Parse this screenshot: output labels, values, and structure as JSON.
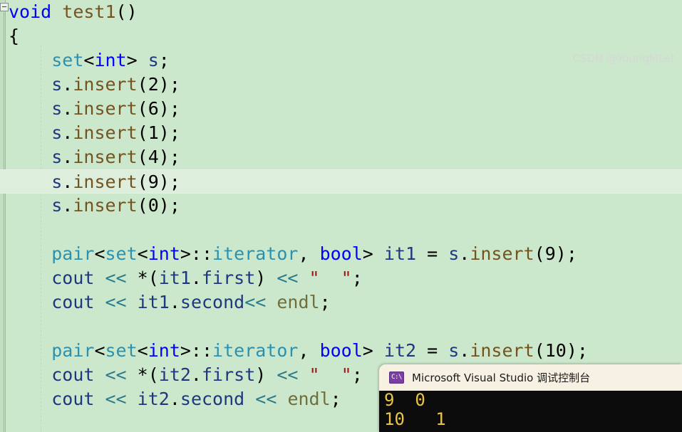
{
  "editor": {
    "outline_marker": "collapse-minus",
    "current_line_index": 7,
    "lines": [
      {
        "indent": 0,
        "tokens": [
          {
            "t": "void",
            "c": "kw"
          },
          {
            "t": " ",
            "c": "op"
          },
          {
            "t": "test1",
            "c": "fn"
          },
          {
            "t": "()",
            "c": "op"
          }
        ]
      },
      {
        "indent": 0,
        "tokens": [
          {
            "t": "{",
            "c": "op"
          }
        ]
      },
      {
        "indent": 1,
        "tokens": [
          {
            "t": "set",
            "c": "type"
          },
          {
            "t": "<",
            "c": "op"
          },
          {
            "t": "int",
            "c": "kw"
          },
          {
            "t": "> ",
            "c": "op"
          },
          {
            "t": "s",
            "c": "var"
          },
          {
            "t": ";",
            "c": "op"
          }
        ]
      },
      {
        "indent": 1,
        "tokens": [
          {
            "t": "s",
            "c": "var"
          },
          {
            "t": ".",
            "c": "op"
          },
          {
            "t": "insert",
            "c": "fn"
          },
          {
            "t": "(",
            "c": "op"
          },
          {
            "t": "2",
            "c": "num"
          },
          {
            "t": ");",
            "c": "op"
          }
        ]
      },
      {
        "indent": 1,
        "tokens": [
          {
            "t": "s",
            "c": "var"
          },
          {
            "t": ".",
            "c": "op"
          },
          {
            "t": "insert",
            "c": "fn"
          },
          {
            "t": "(",
            "c": "op"
          },
          {
            "t": "6",
            "c": "num"
          },
          {
            "t": ");",
            "c": "op"
          }
        ]
      },
      {
        "indent": 1,
        "tokens": [
          {
            "t": "s",
            "c": "var"
          },
          {
            "t": ".",
            "c": "op"
          },
          {
            "t": "insert",
            "c": "fn"
          },
          {
            "t": "(",
            "c": "op"
          },
          {
            "t": "1",
            "c": "num"
          },
          {
            "t": ");",
            "c": "op"
          }
        ]
      },
      {
        "indent": 1,
        "tokens": [
          {
            "t": "s",
            "c": "var"
          },
          {
            "t": ".",
            "c": "op"
          },
          {
            "t": "insert",
            "c": "fn"
          },
          {
            "t": "(",
            "c": "op"
          },
          {
            "t": "4",
            "c": "num"
          },
          {
            "t": ");",
            "c": "op"
          }
        ]
      },
      {
        "indent": 1,
        "tokens": [
          {
            "t": "s",
            "c": "var"
          },
          {
            "t": ".",
            "c": "op"
          },
          {
            "t": "insert",
            "c": "fn"
          },
          {
            "t": "(",
            "c": "op"
          },
          {
            "t": "9",
            "c": "num"
          },
          {
            "t": ");",
            "c": "op"
          }
        ]
      },
      {
        "indent": 1,
        "tokens": [
          {
            "t": "s",
            "c": "var"
          },
          {
            "t": ".",
            "c": "op"
          },
          {
            "t": "insert",
            "c": "fn"
          },
          {
            "t": "(",
            "c": "op"
          },
          {
            "t": "0",
            "c": "num"
          },
          {
            "t": ");",
            "c": "op"
          }
        ]
      },
      {
        "indent": 0,
        "tokens": []
      },
      {
        "indent": 1,
        "tokens": [
          {
            "t": "pair",
            "c": "type"
          },
          {
            "t": "<",
            "c": "op"
          },
          {
            "t": "set",
            "c": "type"
          },
          {
            "t": "<",
            "c": "op"
          },
          {
            "t": "int",
            "c": "kw"
          },
          {
            "t": ">::",
            "c": "op"
          },
          {
            "t": "iterator",
            "c": "type"
          },
          {
            "t": ", ",
            "c": "op"
          },
          {
            "t": "bool",
            "c": "kw"
          },
          {
            "t": "> ",
            "c": "op"
          },
          {
            "t": "it1",
            "c": "var"
          },
          {
            "t": " = ",
            "c": "op"
          },
          {
            "t": "s",
            "c": "var"
          },
          {
            "t": ".",
            "c": "op"
          },
          {
            "t": "insert",
            "c": "fn"
          },
          {
            "t": "(",
            "c": "op"
          },
          {
            "t": "9",
            "c": "num"
          },
          {
            "t": ");",
            "c": "op"
          }
        ]
      },
      {
        "indent": 1,
        "tokens": [
          {
            "t": "cout",
            "c": "var"
          },
          {
            "t": " ",
            "c": "op"
          },
          {
            "t": "<<",
            "c": "shift"
          },
          {
            "t": " *(",
            "c": "op"
          },
          {
            "t": "it1",
            "c": "var"
          },
          {
            "t": ".",
            "c": "op"
          },
          {
            "t": "first",
            "c": "var"
          },
          {
            "t": ") ",
            "c": "op"
          },
          {
            "t": "<<",
            "c": "shift"
          },
          {
            "t": " ",
            "c": "op"
          },
          {
            "t": "\"  \"",
            "c": "str"
          },
          {
            "t": ";",
            "c": "op"
          }
        ]
      },
      {
        "indent": 1,
        "tokens": [
          {
            "t": "cout",
            "c": "var"
          },
          {
            "t": " ",
            "c": "op"
          },
          {
            "t": "<<",
            "c": "shift"
          },
          {
            "t": " ",
            "c": "op"
          },
          {
            "t": "it1",
            "c": "var"
          },
          {
            "t": ".",
            "c": "op"
          },
          {
            "t": "second",
            "c": "var"
          },
          {
            "t": "<<",
            "c": "shift"
          },
          {
            "t": " ",
            "c": "op"
          },
          {
            "t": "endl",
            "c": "macro"
          },
          {
            "t": ";",
            "c": "op"
          }
        ]
      },
      {
        "indent": 0,
        "tokens": []
      },
      {
        "indent": 1,
        "tokens": [
          {
            "t": "pair",
            "c": "type"
          },
          {
            "t": "<",
            "c": "op"
          },
          {
            "t": "set",
            "c": "type"
          },
          {
            "t": "<",
            "c": "op"
          },
          {
            "t": "int",
            "c": "kw"
          },
          {
            "t": ">::",
            "c": "op"
          },
          {
            "t": "iterator",
            "c": "type"
          },
          {
            "t": ", ",
            "c": "op"
          },
          {
            "t": "bool",
            "c": "kw"
          },
          {
            "t": "> ",
            "c": "op"
          },
          {
            "t": "it2",
            "c": "var"
          },
          {
            "t": " = ",
            "c": "op"
          },
          {
            "t": "s",
            "c": "var"
          },
          {
            "t": ".",
            "c": "op"
          },
          {
            "t": "insert",
            "c": "fn"
          },
          {
            "t": "(",
            "c": "op"
          },
          {
            "t": "10",
            "c": "num"
          },
          {
            "t": ");",
            "c": "op"
          }
        ]
      },
      {
        "indent": 1,
        "tokens": [
          {
            "t": "cout",
            "c": "var"
          },
          {
            "t": " ",
            "c": "op"
          },
          {
            "t": "<<",
            "c": "shift"
          },
          {
            "t": " *(",
            "c": "op"
          },
          {
            "t": "it2",
            "c": "var"
          },
          {
            "t": ".",
            "c": "op"
          },
          {
            "t": "first",
            "c": "var"
          },
          {
            "t": ") ",
            "c": "op"
          },
          {
            "t": "<<",
            "c": "shift"
          },
          {
            "t": " ",
            "c": "op"
          },
          {
            "t": "\"  \"",
            "c": "str"
          },
          {
            "t": ";",
            "c": "op"
          }
        ]
      },
      {
        "indent": 1,
        "tokens": [
          {
            "t": "cout",
            "c": "var"
          },
          {
            "t": " ",
            "c": "op"
          },
          {
            "t": "<<",
            "c": "shift"
          },
          {
            "t": " ",
            "c": "op"
          },
          {
            "t": "it2",
            "c": "var"
          },
          {
            "t": ".",
            "c": "op"
          },
          {
            "t": "second",
            "c": "var"
          },
          {
            "t": " ",
            "c": "op"
          },
          {
            "t": "<<",
            "c": "shift"
          },
          {
            "t": " ",
            "c": "op"
          },
          {
            "t": "endl",
            "c": "macro"
          },
          {
            "t": ";",
            "c": "op"
          }
        ]
      }
    ]
  },
  "console": {
    "icon_label": "C:\\",
    "title": "Microsoft Visual Studio 调试控制台",
    "output_lines": [
      "9  0",
      "10   1"
    ]
  },
  "watermark": "CSDN @YoungMLet",
  "colors": {
    "editor_background": "#cce8cc",
    "current_line_background": "#ddeedd",
    "keyword": "#0000ff",
    "type": "#2b91af",
    "function": "#74531f",
    "variable": "#1f377f",
    "string": "#a31515",
    "macro": "#6f6f3d",
    "shift_operator": "#2b7a8c",
    "console_titlebar": "#f7f1e3",
    "console_background": "#0c0c0c",
    "console_text": "#e8c547"
  }
}
